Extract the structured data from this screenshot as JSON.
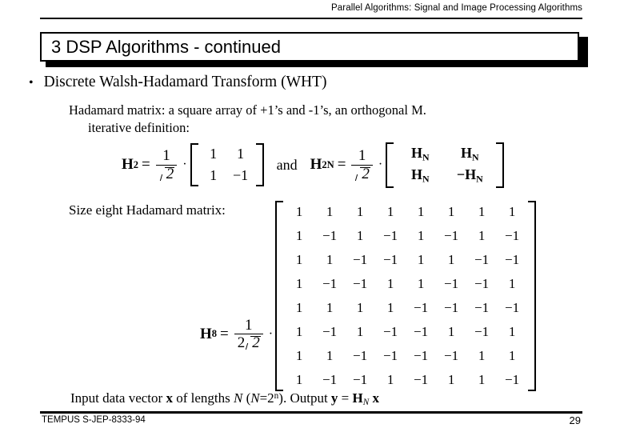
{
  "header": {
    "text": "Parallel Algorithms:  Signal and Image Processing Algorithms"
  },
  "title": {
    "number": "3",
    "text": "3  DSP Algorithms - continued"
  },
  "bullet": {
    "marker": "•",
    "text": "Discrete Walsh-Hadamard Transform (WHT)"
  },
  "body": {
    "line1": "Hadamard matrix: a square array of  +1’s and -1’s, an orthogonal M.",
    "line2": "iterative definition:",
    "size_eight_label": "Size eight Hadamard matrix:"
  },
  "formula_h2": {
    "symbol": "H",
    "subscript": "2",
    "equals": "=",
    "numerator": "1",
    "denominator_prefix": "",
    "denominator_radicand": "2",
    "multiply": "·",
    "matrix": [
      [
        "1",
        "1"
      ],
      [
        "1",
        "−1"
      ]
    ]
  },
  "conjunction": "and",
  "formula_h2n": {
    "symbol": "H",
    "subscript": "2N",
    "equals": "=",
    "numerator": "1",
    "denominator_radicand": "2",
    "multiply": "·",
    "matrix": [
      [
        "H",
        "H"
      ],
      [
        "H",
        "−H"
      ]
    ],
    "entry_subscript": "N"
  },
  "formula_h8": {
    "symbol": "H",
    "subscript": "8",
    "equals": "=",
    "numerator": "1",
    "denominator_prefix": "2",
    "denominator_radicand": "2",
    "multiply": "·",
    "matrix": [
      [
        "1",
        "1",
        "1",
        "1",
        "1",
        "1",
        "1",
        "1"
      ],
      [
        "1",
        "−1",
        "1",
        "−1",
        "1",
        "−1",
        "1",
        "−1"
      ],
      [
        "1",
        "1",
        "−1",
        "−1",
        "1",
        "1",
        "−1",
        "−1"
      ],
      [
        "1",
        "−1",
        "−1",
        "1",
        "1",
        "−1",
        "−1",
        "1"
      ],
      [
        "1",
        "1",
        "1",
        "1",
        "−1",
        "−1",
        "−1",
        "−1"
      ],
      [
        "1",
        "−1",
        "1",
        "−1",
        "−1",
        "1",
        "−1",
        "1"
      ],
      [
        "1",
        "1",
        "−1",
        "−1",
        "−1",
        "−1",
        "1",
        "1"
      ],
      [
        "1",
        "−1",
        "−1",
        "1",
        "−1",
        "1",
        "1",
        "−1"
      ]
    ]
  },
  "bottom": {
    "part1": "Input data vector ",
    "vector_x": "x",
    "part2": " of lengths  ",
    "var_N": "N",
    "part3": "  (",
    "var_N2": "N",
    "part4": "=2",
    "exp_n": "n",
    "part5": ").  Output ",
    "vector_y": "y",
    "part6": " = ",
    "matrix_H": "H",
    "matrix_H_sub": "N",
    "part7": " x"
  },
  "footer": {
    "left": "TEMPUS S-JEP-8333-94",
    "page": "29"
  },
  "colors": {
    "ink": "#000000",
    "background": "#ffffff"
  }
}
